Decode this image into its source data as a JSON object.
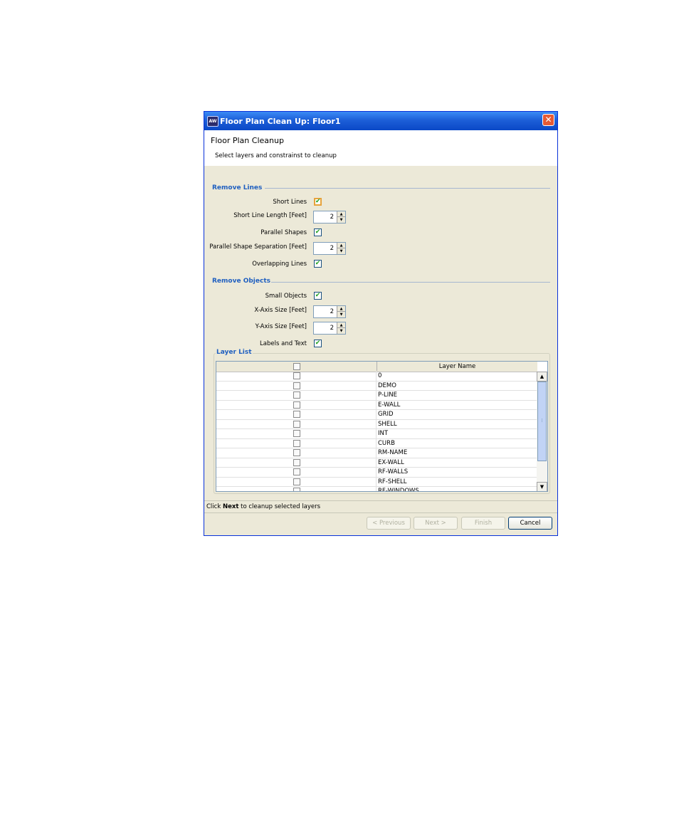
{
  "window": {
    "title": "Floor Plan Clean Up: Floor1",
    "app_icon_text": "AW"
  },
  "header": {
    "title": "Floor Plan Cleanup",
    "subtitle": "Select layers and constrainst to cleanup"
  },
  "remove_lines": {
    "title": "Remove Lines",
    "short_lines_label": "Short Lines",
    "short_lines_checked": true,
    "short_line_length_label": "Short Line Length [Feet]",
    "short_line_length_value": "2",
    "parallel_shapes_label": "Parallel Shapes",
    "parallel_shapes_checked": true,
    "parallel_shape_sep_label": "Parallel Shape Separation [Feet]",
    "parallel_shape_sep_value": "2",
    "overlapping_lines_label": "Overlapping Lines",
    "overlapping_lines_checked": true
  },
  "remove_objects": {
    "title": "Remove Objects",
    "small_objects_label": "Small Objects",
    "small_objects_checked": true,
    "x_axis_label": "X-Axis Size [Feet]",
    "x_axis_value": "2",
    "y_axis_label": "Y-Axis Size [Feet]",
    "y_axis_value": "2",
    "labels_text_label": "Labels and Text",
    "labels_text_checked": true
  },
  "layer_list": {
    "title": "Layer List",
    "column_header": "Layer Name",
    "layers": [
      "0",
      "DEMO",
      "P-LINE",
      "E-WALL",
      "GRID",
      "SHELL",
      "INT",
      "CURB",
      "RM-NAME",
      "EX-WALL",
      "RF-WALLS",
      "RF-SHELL",
      "RF-WINDOWS"
    ]
  },
  "status": {
    "prefix": "Click ",
    "bold": "Next",
    "suffix": " to cleanup selected layers"
  },
  "buttons": {
    "previous": "< Previous",
    "next": "Next >",
    "finish": "Finish",
    "cancel": "Cancel"
  },
  "icons": {
    "check": "✔",
    "up": "▲",
    "down": "▼",
    "close": "✕",
    "grip": "⁞"
  }
}
